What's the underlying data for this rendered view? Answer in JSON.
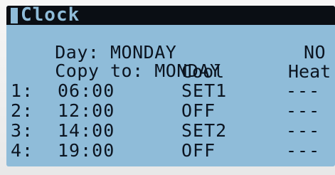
{
  "screen": {
    "title": "Clock",
    "day_label": "Day:",
    "day_value": "MONDAY",
    "copy_label": "Copy to:",
    "copy_value": "MONDAY",
    "copy_flag": "NO"
  },
  "columns": {
    "cool": "Cool",
    "heat": "Heat"
  },
  "rows": [
    {
      "index": "1:",
      "time": "06:00",
      "cool": "SET1",
      "heat": "---"
    },
    {
      "index": "2:",
      "time": "12:00",
      "cool": "OFF",
      "heat": "---"
    },
    {
      "index": "3:",
      "time": "14:00",
      "cool": "SET2",
      "heat": "---"
    },
    {
      "index": "4:",
      "time": "19:00",
      "cool": "OFF",
      "heat": "---"
    }
  ],
  "colors": {
    "lcd_background": "#8fbcd9",
    "lcd_text": "#0b1420",
    "title_bar": "#0a0e14"
  }
}
